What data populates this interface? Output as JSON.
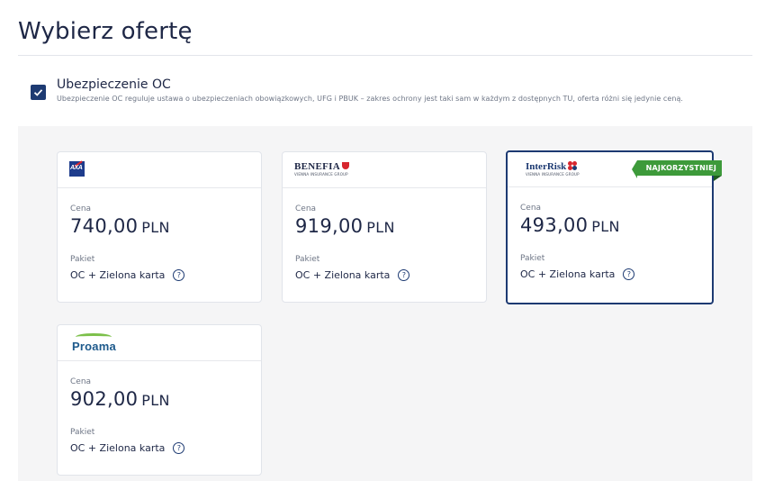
{
  "page": {
    "title": "Wybierz ofertę"
  },
  "section": {
    "title": "Ubezpieczenie OC",
    "description": "Ubezpieczenie OC reguluje ustawa o ubezpieczeniach obowiązkowych, UFG i PBUK – zakres ochrony jest taki sam w każdym z dostępnych TU, oferta różni się jedynie ceną.",
    "checked": true
  },
  "offers": [
    {
      "insurer": "AXA",
      "logo_icon": "axa-logo-icon",
      "price_label": "Cena",
      "price": "740,00",
      "currency": "PLN",
      "package_label": "Pakiet",
      "package": "OC + Zielona karta",
      "help": "?"
    },
    {
      "insurer": "BENEFIA",
      "insurer_sub": "VIENNA INSURANCE GROUP",
      "logo_icon": "benefia-logo-icon",
      "price_label": "Cena",
      "price": "919,00",
      "currency": "PLN",
      "package_label": "Pakiet",
      "package": "OC + Zielona karta",
      "help": "?"
    },
    {
      "insurer": "InterRisk",
      "insurer_sub": "VIENNA INSURANCE GROUP",
      "logo_icon": "interrisk-logo-icon",
      "price_label": "Cena",
      "price": "493,00",
      "currency": "PLN",
      "package_label": "Pakiet",
      "package": "OC + Zielona karta",
      "help": "?",
      "badge": "NAJKORZYSTNIEJ"
    },
    {
      "insurer": "Proama",
      "logo_icon": "proama-logo-icon",
      "price_label": "Cena",
      "price": "902,00",
      "currency": "PLN",
      "package_label": "Pakiet",
      "package": "OC + Zielona karta",
      "help": "?"
    }
  ],
  "colors": {
    "primary": "#1d3a72",
    "badge": "#3d9a3a",
    "panel": "#f5f5f6"
  }
}
